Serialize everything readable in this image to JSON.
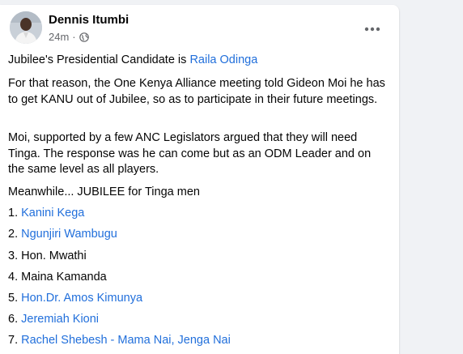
{
  "post": {
    "author": "Dennis Itumbi",
    "time": "24m",
    "separator": "·",
    "line1_prefix": "Jubilee's Presidential Candidate is ",
    "line1_link": "Raila Odinga",
    "para2": "For that reason, the One Kenya Alliance meeting told Gideon Moi he has to get KANU out of Jubilee, so as to participate in their future meetings.",
    "para3": "Moi, supported by a few ANC Legislators argued that they will need Tinga. The response was he can come but as an ODM Leader and on the same level as all players.",
    "para4": "Meanwhile... JUBILEE for Tinga men",
    "list": [
      {
        "num": "1. ",
        "name": "Kanini Kega",
        "link": true
      },
      {
        "num": "2. ",
        "name": "Ngunjiri Wambugu",
        "link": true
      },
      {
        "num": "3. ",
        "name": "Hon. Mwathi",
        "link": false
      },
      {
        "num": "4. ",
        "name": "Maina Kamanda",
        "link": false
      },
      {
        "num": "5. ",
        "name": "Hon.Dr. Amos Kimunya",
        "link": true
      },
      {
        "num": "6. ",
        "name": "Jeremiah Kioni",
        "link": true
      },
      {
        "num": "7. ",
        "name": "Rachel Shebesh - Mama Nai, Jenga Nai",
        "link": true
      }
    ]
  },
  "icons": {
    "privacy": "globe-icon",
    "more": "more-options-icon"
  },
  "colors": {
    "link": "#216fdb",
    "text": "#050505",
    "secondary": "#65676b",
    "background": "#f0f2f5"
  }
}
